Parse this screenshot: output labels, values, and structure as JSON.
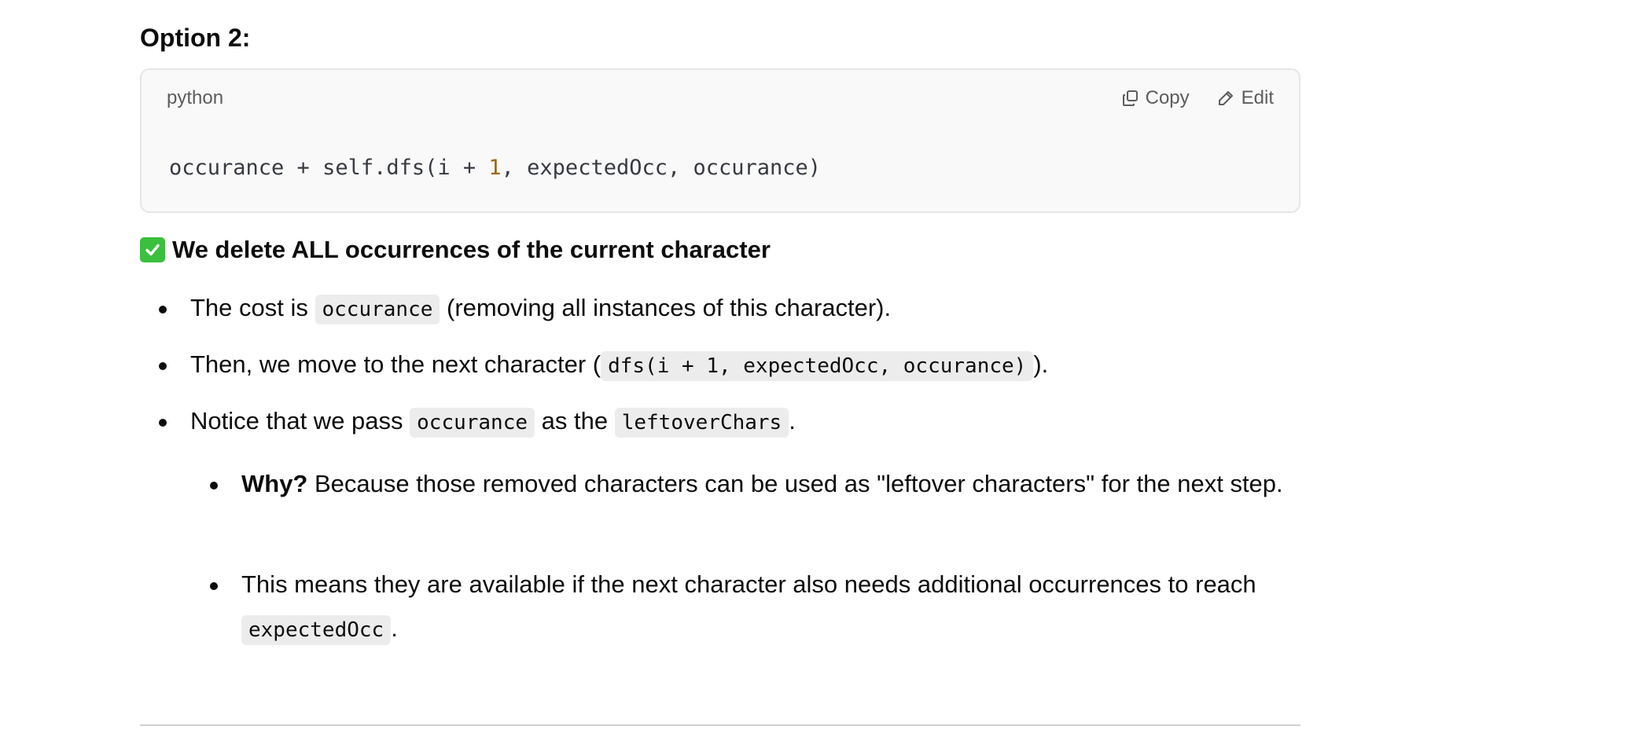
{
  "heading": "Option 2:",
  "code_block": {
    "language": "python",
    "copy_label": "Copy",
    "edit_label": "Edit",
    "code_before": "occurance + self.dfs(i + ",
    "code_number": "1",
    "code_after": ", expectedOcc, occurance)"
  },
  "check_heading": {
    "emoji": "check-mark-icon",
    "text": "We delete ALL occurrences of the current character"
  },
  "bullets": [
    {
      "before": "The cost is ",
      "code": "occurance",
      "after": " (removing all instances of this character)."
    },
    {
      "before": "Then, we move to the next character (",
      "code": "dfs(i + 1, expectedOcc, occurance)",
      "after": ")."
    },
    {
      "before": "Notice that we pass ",
      "code": "occurance",
      "middle": " as the ",
      "code2": "leftoverChars",
      "after": "."
    }
  ],
  "sub_bullets": [
    {
      "bold": "Why?",
      "text": " Because those removed characters can be used as \"leftover characters\" for the next step."
    },
    {
      "before": "This means they are available if the next character also needs additional occurrences to reach ",
      "code": "expectedOcc",
      "after": "."
    }
  ],
  "colors": {
    "code_number": "#a0650a",
    "check_green": "#3bbf3e",
    "inline_code_bg": "#ececec",
    "code_block_bg": "#f9f9f9"
  }
}
